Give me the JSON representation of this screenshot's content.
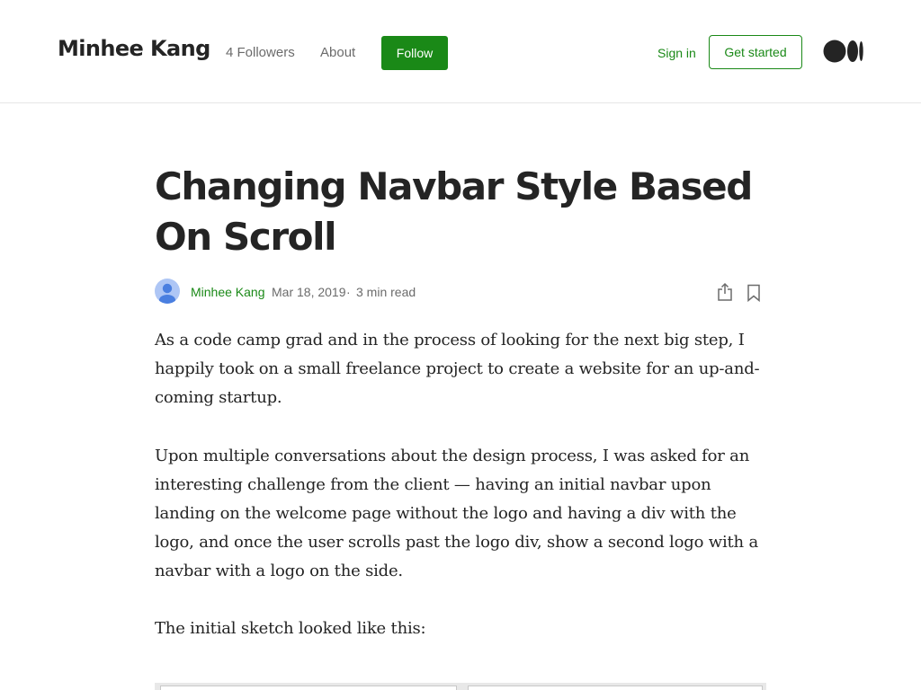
{
  "header": {
    "brand": "Minhee Kang",
    "followers": "4 Followers",
    "about": "About",
    "follow_label": "Follow",
    "signin_label": "Sign in",
    "get_started_label": "Get started",
    "logo_icon": "medium-logo-icon"
  },
  "article": {
    "title": "Changing Navbar Style Based On Scroll",
    "author": "Minhee Kang",
    "date": "Mar 18, 2019",
    "separator": "·",
    "read_time": "3 min read",
    "paragraphs": [
      "As a code camp grad and in the process of looking for the next big step, I happily took on a small freelance project to create a website for an up-and-coming startup.",
      "Upon multiple conversations about the design process, I was asked for an interesting challenge from the client — having an initial navbar upon landing on the welcome page without the logo and having a div with the logo, and once the user scrolls past the logo div, show a second logo with a navbar with a logo on the side.",
      "The initial sketch looked like this:"
    ]
  },
  "colors": {
    "accent": "#1a8917",
    "text": "#242424",
    "muted": "#6b6b6b"
  }
}
